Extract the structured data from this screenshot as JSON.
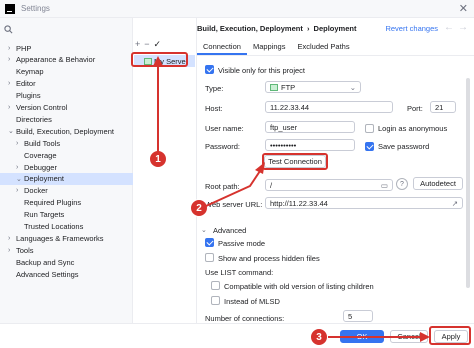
{
  "window": {
    "title": "Settings"
  },
  "sidebar": {
    "items": [
      {
        "label": "PHP",
        "arrow": "›"
      },
      {
        "label": "Appearance & Behavior",
        "arrow": "›"
      },
      {
        "label": "Keymap",
        "arrow": ""
      },
      {
        "label": "Editor",
        "arrow": "›"
      },
      {
        "label": "Plugins",
        "arrow": ""
      },
      {
        "label": "Version Control",
        "arrow": "›"
      },
      {
        "label": "Directories",
        "arrow": ""
      },
      {
        "label": "Build, Execution, Deployment",
        "arrow": "⌄"
      },
      {
        "label": "Build Tools",
        "arrow": "›"
      },
      {
        "label": "Coverage",
        "arrow": ""
      },
      {
        "label": "Debugger",
        "arrow": "›"
      },
      {
        "label": "Deployment",
        "arrow": "⌄"
      },
      {
        "label": "Docker",
        "arrow": "›"
      },
      {
        "label": "Required Plugins",
        "arrow": ""
      },
      {
        "label": "Run Targets",
        "arrow": ""
      },
      {
        "label": "Trusted Locations",
        "arrow": ""
      },
      {
        "label": "Languages & Frameworks",
        "arrow": "›"
      },
      {
        "label": "Tools",
        "arrow": "›"
      },
      {
        "label": "Backup and Sync",
        "arrow": ""
      },
      {
        "label": "Advanced Settings",
        "arrow": ""
      }
    ]
  },
  "servers": {
    "toolbar": [
      "+",
      "−",
      "✓"
    ],
    "selected": "My Server"
  },
  "header": {
    "breadcrumb_parent": "Build, Execution, Deployment",
    "breadcrumb_sep": "›",
    "breadcrumb_current": "Deployment",
    "revert": "Revert changes"
  },
  "tabs": [
    "Connection",
    "Mappings",
    "Excluded Paths"
  ],
  "form": {
    "visible_only": "Visible only for this project",
    "type_label": "Type:",
    "type_value": "FTP",
    "host_label": "Host:",
    "host_value": "11.22.33.44",
    "port_label": "Port:",
    "port_value": "21",
    "user_label": "User name:",
    "user_value": "ftp_user",
    "anon_label": "Login as anonymous",
    "password_label": "Password:",
    "password_value": "••••••••••",
    "save_password_label": "Save password",
    "test_button": "Test Connection",
    "root_label": "Root path:",
    "root_value": "/",
    "autodetect": "Autodetect",
    "weburl_label": "Web server URL:",
    "weburl_value": "http://11.22.33.44",
    "advanced": "Advanced",
    "passive": "Passive mode",
    "hidden_files": "Show and process hidden files",
    "list_cmd": "Use  LIST command:",
    "compat": "Compatible with old version of listing children",
    "mlsd": "Instead of MLSD",
    "num_conn_label": "Number of connections:",
    "num_conn_value": "5"
  },
  "footer": {
    "ok": "OK",
    "cancel": "Cancel",
    "apply": "Apply"
  },
  "annotations": [
    "1",
    "2",
    "3"
  ],
  "colors": {
    "accent": "#3574f0",
    "highlight": "#d4e2ff",
    "annotation": "#d6332e"
  }
}
